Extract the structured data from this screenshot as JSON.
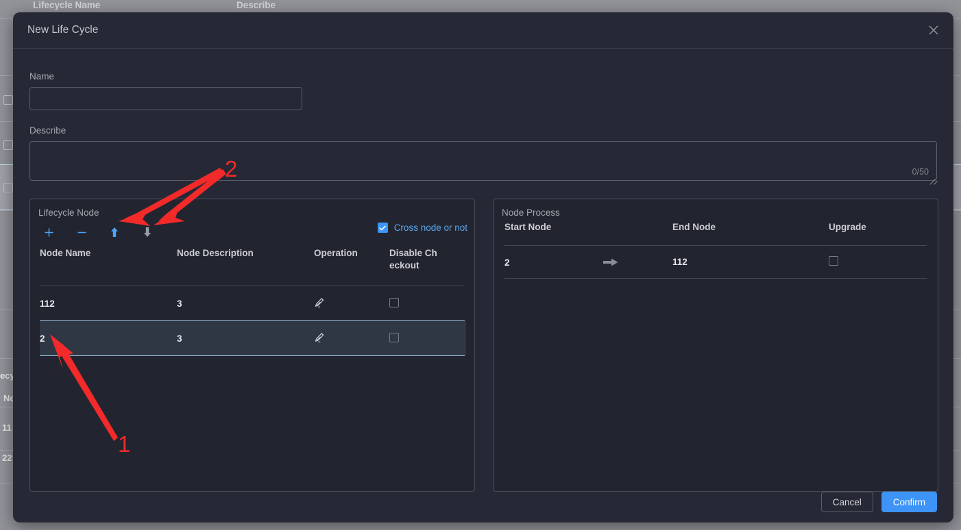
{
  "background": {
    "columns": [
      "Lifecycle Name",
      "Describe"
    ],
    "left_fragments": [
      "ifecy",
      "No",
      "11",
      "22"
    ]
  },
  "dialog": {
    "title": "New Life Cycle",
    "close_icon": "close-icon",
    "name": {
      "label": "Name",
      "value": "",
      "placeholder": ""
    },
    "describe": {
      "label": "Describe",
      "value": "",
      "placeholder": "",
      "counter": "0/50"
    },
    "footer": {
      "cancel_label": "Cancel",
      "confirm_label": "Confirm"
    }
  },
  "lifecycle_node": {
    "title": "Lifecycle Node",
    "toolbar": [
      {
        "name": "add-node-button",
        "icon": "plus-icon",
        "enabled": true
      },
      {
        "name": "remove-node-button",
        "icon": "minus-icon",
        "enabled": true
      },
      {
        "name": "move-up-button",
        "icon": "arrow-up-icon",
        "enabled": true
      },
      {
        "name": "move-down-button",
        "icon": "arrow-down-icon",
        "enabled": false
      }
    ],
    "cross_node": {
      "label": "Cross node or not",
      "checked": true
    },
    "columns": [
      "Node Name",
      "Node Description",
      "Operation",
      "Disable Ch eckout"
    ],
    "rows": [
      {
        "node_name": "112",
        "node_description": "3",
        "operation_icon": "pencil-icon",
        "disable_checkout": false,
        "selected": false
      },
      {
        "node_name": "2",
        "node_description": "3",
        "operation_icon": "pencil-icon",
        "disable_checkout": false,
        "selected": true
      }
    ]
  },
  "node_process": {
    "title": "Node Process",
    "columns": [
      "Start Node",
      "End Node",
      "Upgrade"
    ],
    "rows": [
      {
        "start_node": "2",
        "arrow_icon": "arrow-right-icon",
        "end_node": "112",
        "upgrade": false
      }
    ]
  },
  "annotations": [
    {
      "label": "1"
    },
    {
      "label": "2"
    }
  ],
  "colors": {
    "accent": "#3d94f6",
    "annotation": "#f22a2a",
    "panel_bg": "#22252f",
    "modal_bg": "#262935",
    "selected_row": "#2f3644"
  }
}
